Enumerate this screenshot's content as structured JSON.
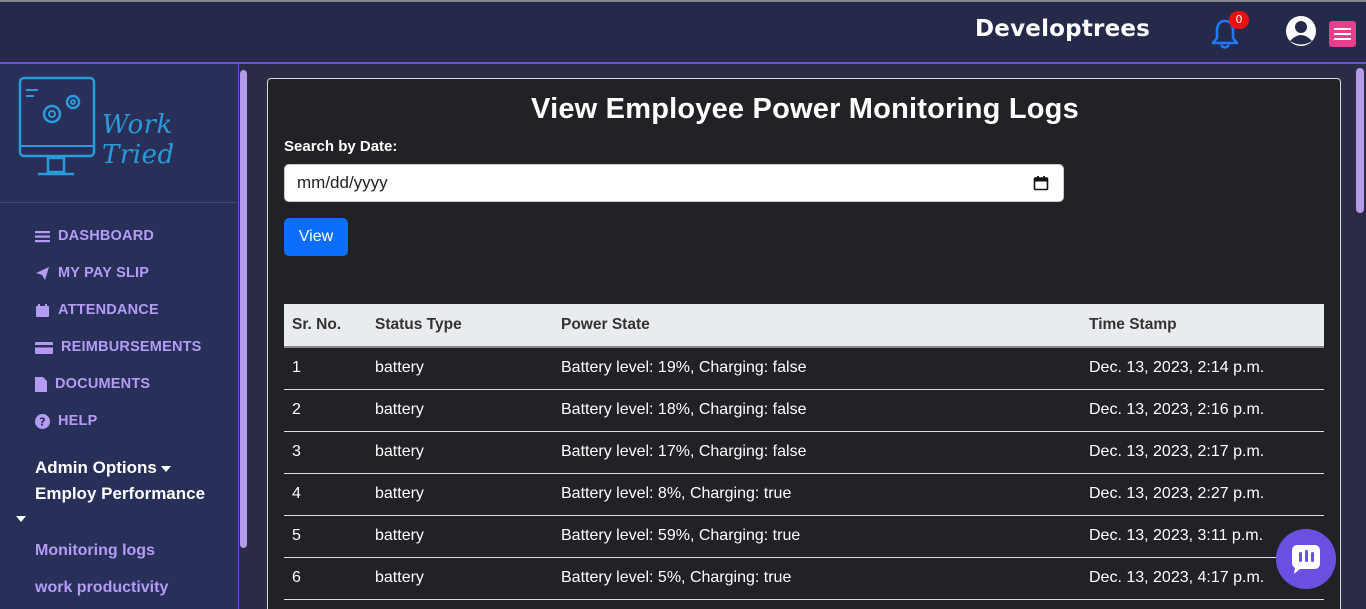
{
  "topbar": {
    "brand": "Developtrees",
    "notification_count": "0"
  },
  "sidebar": {
    "logo_text": "Work Tried",
    "items": [
      {
        "label": "DASHBOARD",
        "icon": "bars-icon"
      },
      {
        "label": "MY PAY SLIP",
        "icon": "paper-plane-icon"
      },
      {
        "label": "ATTENDANCE",
        "icon": "calendar-icon"
      },
      {
        "label": "REIMBURSEMENTS",
        "icon": "credit-card-icon"
      },
      {
        "label": "DOCUMENTS",
        "icon": "file-icon"
      },
      {
        "label": "HELP",
        "icon": "question-circle-icon"
      }
    ],
    "admin_options": "Admin Options",
    "employ_performance": "Employ Performance",
    "sub_items": [
      "Monitoring logs",
      "work productivity"
    ]
  },
  "main": {
    "title": "View Employee Power Monitoring Logs",
    "search_label": "Search by Date:",
    "date_placeholder": "mm/dd/yyyy",
    "view_button": "View",
    "table": {
      "headers": [
        "Sr. No.",
        "Status Type",
        "Power State",
        "Time Stamp"
      ],
      "rows": [
        [
          "1",
          "battery",
          "Battery level: 19%, Charging: false",
          "Dec. 13, 2023, 2:14 p.m."
        ],
        [
          "2",
          "battery",
          "Battery level: 18%, Charging: false",
          "Dec. 13, 2023, 2:16 p.m."
        ],
        [
          "3",
          "battery",
          "Battery level: 17%, Charging: false",
          "Dec. 13, 2023, 2:17 p.m."
        ],
        [
          "4",
          "battery",
          "Battery level: 8%, Charging: true",
          "Dec. 13, 2023, 2:27 p.m."
        ],
        [
          "5",
          "battery",
          "Battery level: 59%, Charging: true",
          "Dec. 13, 2023, 3:11 p.m."
        ],
        [
          "6",
          "battery",
          "Battery level: 5%, Charging: true",
          "Dec. 13, 2023, 4:17 p.m."
        ]
      ]
    }
  },
  "colors": {
    "topbar": "#262a4a",
    "sidebar": "#28305a",
    "accent": "#6f4fd8",
    "nav_text": "#b49cf5",
    "primary_button": "#0d6efd",
    "menu_button": "#e83e8c"
  }
}
